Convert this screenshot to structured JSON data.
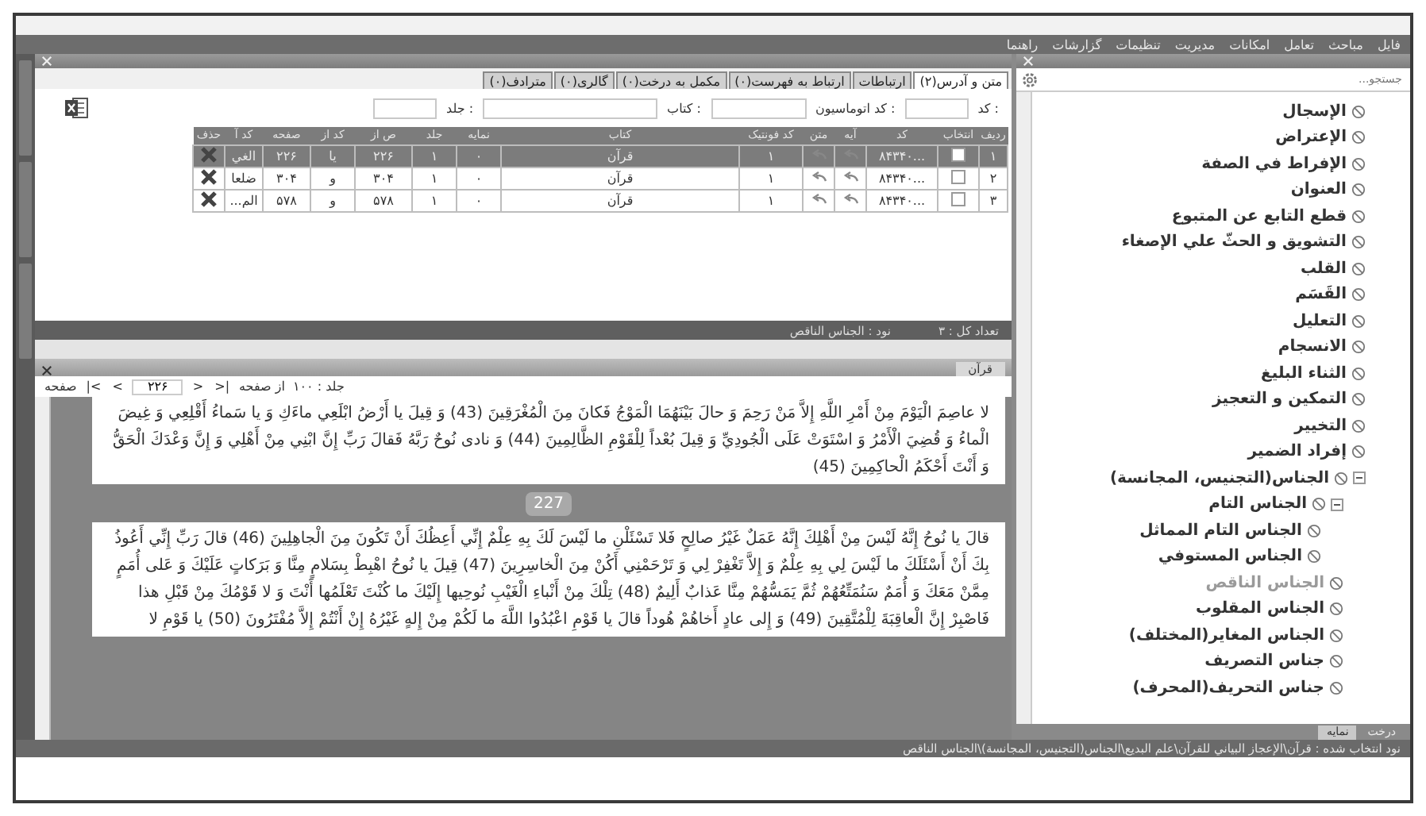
{
  "menu": [
    "فایل",
    "مباحث",
    "تعامل",
    "امکانات",
    "مدیریت",
    "تنظیمات",
    "گزارشات",
    "راهنما"
  ],
  "tabs": [
    {
      "label": "متن و آدرس(۲)",
      "selected": true
    },
    {
      "label": "ارتباطات",
      "selected": false
    },
    {
      "label": "ارتباط به فهرست(۰)",
      "selected": false
    },
    {
      "label": "مکمل به درخت(۰)",
      "selected": false
    },
    {
      "label": "گالری(۰)",
      "selected": false
    },
    {
      "label": "مترادف(۰)",
      "selected": false
    }
  ],
  "filters": [
    {
      "label": "کد :"
    },
    {
      "label": "کد اتوماسیون :"
    },
    {
      "label": "کتاب :"
    },
    {
      "label": "جلد :"
    }
  ],
  "table": {
    "columns": [
      "ردیف",
      "انتخاب",
      "کد",
      "آیه",
      "متن",
      "کد فونتیک",
      "کتاب",
      "نمایه",
      "جلد",
      "ص از",
      "کد از",
      "صفحه",
      "کد آ",
      "حذف"
    ],
    "rows": [
      {
        "selected": true,
        "cells": [
          {
            "kind": "text",
            "text": "۱"
          },
          {
            "kind": "check",
            "checked": false
          },
          {
            "kind": "text",
            "text": "...۸۴۳۴۰"
          },
          {
            "kind": "jump"
          },
          {
            "kind": "jump"
          },
          {
            "kind": "text",
            "text": "۱"
          },
          {
            "kind": "text",
            "text": "قرآن"
          },
          {
            "kind": "text",
            "text": "٠"
          },
          {
            "kind": "text",
            "text": "۱"
          },
          {
            "kind": "text",
            "text": "۲۲۶"
          },
          {
            "kind": "text",
            "text": "یا"
          },
          {
            "kind": "text",
            "text": "۲۲۶"
          },
          {
            "kind": "text",
            "text": "الغي"
          },
          {
            "kind": "delete"
          }
        ]
      },
      {
        "selected": false,
        "cells": [
          {
            "kind": "text",
            "text": "۲"
          },
          {
            "kind": "check",
            "checked": false
          },
          {
            "kind": "text",
            "text": "...۸۴۳۴۰"
          },
          {
            "kind": "jump"
          },
          {
            "kind": "jump"
          },
          {
            "kind": "text",
            "text": "۱"
          },
          {
            "kind": "text",
            "text": "قرآن"
          },
          {
            "kind": "text",
            "text": "٠"
          },
          {
            "kind": "text",
            "text": "۱"
          },
          {
            "kind": "text",
            "text": "۳۰۴"
          },
          {
            "kind": "text",
            "text": "و"
          },
          {
            "kind": "text",
            "text": "۳۰۴"
          },
          {
            "kind": "text",
            "text": "ضلعا"
          },
          {
            "kind": "delete"
          }
        ]
      },
      {
        "selected": false,
        "cells": [
          {
            "kind": "text",
            "text": "۳"
          },
          {
            "kind": "check",
            "checked": false
          },
          {
            "kind": "text",
            "text": "...۸۴۳۴۰"
          },
          {
            "kind": "jump"
          },
          {
            "kind": "jump"
          },
          {
            "kind": "text",
            "text": "۱"
          },
          {
            "kind": "text",
            "text": "قرآن"
          },
          {
            "kind": "text",
            "text": "٠"
          },
          {
            "kind": "text",
            "text": "۱"
          },
          {
            "kind": "text",
            "text": "۵۷۸"
          },
          {
            "kind": "text",
            "text": "و"
          },
          {
            "kind": "text",
            "text": "۵۷۸"
          },
          {
            "kind": "text",
            "text": "الم..."
          },
          {
            "kind": "delete"
          }
        ]
      }
    ]
  },
  "count_bar": {
    "total": "تعداد کل : ۳",
    "node": "نود : الجناس الناقص"
  },
  "quran": {
    "tab": "قرآن",
    "toolbar": {
      "page_label": "صفحه",
      "first": "|<",
      "prev": "<",
      "page": "۲۲۶",
      "next": ">",
      "last": ">|",
      "of_label": "از صفحه",
      "volume": "جلد : ۱۰۰"
    },
    "blocks": [
      {
        "text": "لا عاصِمَ الْيَوْمَ مِنْ أَمْرِ اللَّهِ إِلاَّ مَنْ رَحِمَ وَ حالَ بَيْنَهُمَا الْمَوْجُ فَكانَ مِنَ الْمُغْرَقِينَ (43) وَ قِيلَ يا أَرْضُ ابْلَعِي ماءَكِ وَ يا سَماءُ أَقْلِعِي وَ غِيضَ الْماءُ وَ قُضِيَ الْأَمْرُ وَ اسْتَوَتْ عَلَى الْجُودِيِّ وَ قِيلَ بُعْداً لِلْقَوْمِ الظَّالِمِينَ (44) وَ نادى نُوحٌ رَبَّهُ فَقالَ رَبِّ إِنَّ ابْنِي مِنْ أَهْلِي وَ إِنَّ وَعْدَكَ الْحَقُّ وَ أَنْتَ أَحْكَمُ الْحاكِمِينَ (45)"
      },
      {
        "page": "227",
        "text": "قالَ يا نُوحُ إِنَّهُ لَيْسَ مِنْ أَهْلِكَ إِنَّهُ عَمَلٌ غَيْرُ صالِحٍ فَلا تَسْئَلْنِ ما لَيْسَ لَكَ بِهِ عِلْمٌ إِنِّي أَعِظُكَ أَنْ تَكُونَ مِنَ الْجاهِلِينَ (46) قالَ رَبِّ إِنِّي أَعُوذُ بِكَ أَنْ أَسْئَلَكَ ما لَيْسَ لِي بِهِ عِلْمٌ وَ إِلاَّ تَغْفِرْ لِي وَ تَرْحَمْنِي أَكُنْ مِنَ الْخاسِرِينَ (47) قِيلَ يا نُوحُ اهْبِطْ بِسَلامٍ مِنَّا وَ بَرَكاتٍ عَلَيْكَ وَ عَلى أُمَمٍ مِمَّنْ مَعَكَ وَ أُمَمٌ سَنُمَتِّعُهُمْ ثُمَّ يَمَسُّهُمْ مِنَّا عَذابٌ أَلِيمٌ (48) تِلْكَ مِنْ أَنْباءِ الْغَيْبِ نُوحِيها إِلَيْكَ ما كُنْتَ تَعْلَمُها أَنْتَ وَ لا قَوْمُكَ مِنْ قَبْلِ هذا فَاصْبِرْ إِنَّ الْعاقِبَةَ لِلْمُتَّقِينَ (49) وَ إِلى عادٍ أَخاهُمْ هُوداً قالَ يا قَوْمِ اعْبُدُوا اللَّهَ ما لَكُمْ مِنْ إِلهٍ غَيْرُهُ إِنْ أَنْتُمْ إِلاَّ مُفْتَرُونَ (50) يا قَوْمِ لا"
      }
    ]
  },
  "tree": {
    "search": {
      "placeholder": "جستجو..."
    },
    "items": [
      {
        "label": "الإسجال",
        "selected": false
      },
      {
        "label": "الإعتراض",
        "selected": false
      },
      {
        "label": "الإفراط في الصفة",
        "selected": false
      },
      {
        "label": "العنوان",
        "selected": false
      },
      {
        "label": "قطع التابع عن المتبوع",
        "selected": false
      },
      {
        "label": "التشويق و الحثّ علي الإصغاء",
        "selected": false
      },
      {
        "label": "القلب",
        "selected": false
      },
      {
        "label": "القَسَم",
        "selected": false
      },
      {
        "label": "التعليل",
        "selected": false
      },
      {
        "label": "الانسجام",
        "selected": false
      },
      {
        "label": "الثناء البليغ",
        "selected": false
      },
      {
        "label": "التمكين و التعجيز",
        "selected": false
      },
      {
        "label": "التخيير",
        "selected": false
      },
      {
        "label": "إفراد الضمير",
        "selected": false
      },
      {
        "label": "الجناس(التجنيس، المجانسة)",
        "selected": false,
        "expanded": true,
        "children": [
          {
            "label": "الجناس التام",
            "selected": false,
            "expanded": true,
            "children": [
              {
                "label": "الجناس التام المماثل",
                "selected": false
              },
              {
                "label": "الجناس المستوفي",
                "selected": false
              }
            ]
          },
          {
            "label": "الجناس الناقص",
            "selected": true
          },
          {
            "label": "الجناس المقلوب",
            "selected": false
          },
          {
            "label": "الجناس المغاير(المختلف)",
            "selected": false
          },
          {
            "label": "جناس التصريف",
            "selected": false
          },
          {
            "label": "جناس التحريف(المحرف)",
            "selected": false
          }
        ]
      }
    ]
  },
  "bottom_tabs": [
    {
      "label": "درخت",
      "selected": false
    },
    {
      "label": "نمایه",
      "selected": true
    }
  ],
  "status_bar": "نود انتخاب شده : قرآن\\الإعجاز البياني للقرآن\\علم البديع\\الجناس(التجنيس، المجانسة)\\الجناس الناقص"
}
